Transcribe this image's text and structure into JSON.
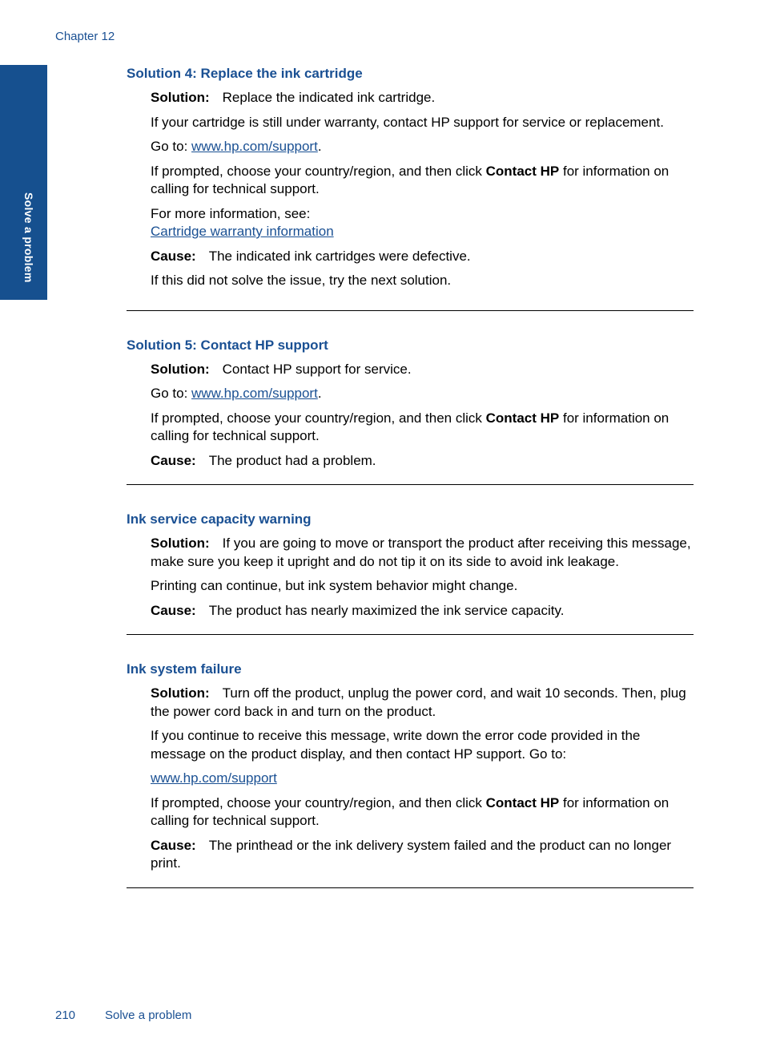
{
  "header": {
    "chapter": "Chapter 12"
  },
  "side_tab": {
    "label": "Solve a problem",
    "color": "#16508f"
  },
  "sections": [
    {
      "title": "Solution 4: Replace the ink cartridge",
      "solution_label": "Solution:",
      "solution_text": "Replace the indicated ink cartridge.",
      "p1": "If your cartridge is still under warranty, contact HP support for service or replacement.",
      "goto_prefix": "Go to: ",
      "goto_link": "www.hp.com/support",
      "goto_suffix": ".",
      "prompt_prefix": "If prompted, choose your country/region, and then click ",
      "prompt_bold": "Contact HP",
      "prompt_suffix": " for information on calling for technical support.",
      "more_info": "For more information, see:",
      "more_link": "Cartridge warranty information",
      "cause_label": "Cause:",
      "cause_text": "The indicated ink cartridges were defective.",
      "next": "If this did not solve the issue, try the next solution."
    },
    {
      "title": "Solution 5: Contact HP support",
      "solution_label": "Solution:",
      "solution_text": "Contact HP support for service.",
      "goto_prefix": "Go to: ",
      "goto_link": "www.hp.com/support",
      "goto_suffix": ".",
      "prompt_prefix": "If prompted, choose your country/region, and then click ",
      "prompt_bold": "Contact HP",
      "prompt_suffix": " for information on calling for technical support.",
      "cause_label": "Cause:",
      "cause_text": "The product had a problem."
    },
    {
      "title": "Ink service capacity warning",
      "solution_label": "Solution:",
      "solution_text": "If you are going to move or transport the product after receiving this message, make sure you keep it upright and do not tip it on its side to avoid ink leakage.",
      "p1": "Printing can continue, but ink system behavior might change.",
      "cause_label": "Cause:",
      "cause_text": "The product has nearly maximized the ink service capacity."
    },
    {
      "title": "Ink system failure",
      "solution_label": "Solution:",
      "solution_text": "Turn off the product, unplug the power cord, and wait 10 seconds. Then, plug the power cord back in and turn on the product.",
      "p1": "If you continue to receive this message, write down the error code provided in the message on the product display, and then contact HP support. Go to:",
      "link": "www.hp.com/support",
      "prompt_prefix": "If prompted, choose your country/region, and then click ",
      "prompt_bold": "Contact HP",
      "prompt_suffix": " for information on calling for technical support.",
      "cause_label": "Cause:",
      "cause_text": "The printhead or the ink delivery system failed and the product can no longer print."
    }
  ],
  "footer": {
    "page_number": "210",
    "title": "Solve a problem"
  }
}
